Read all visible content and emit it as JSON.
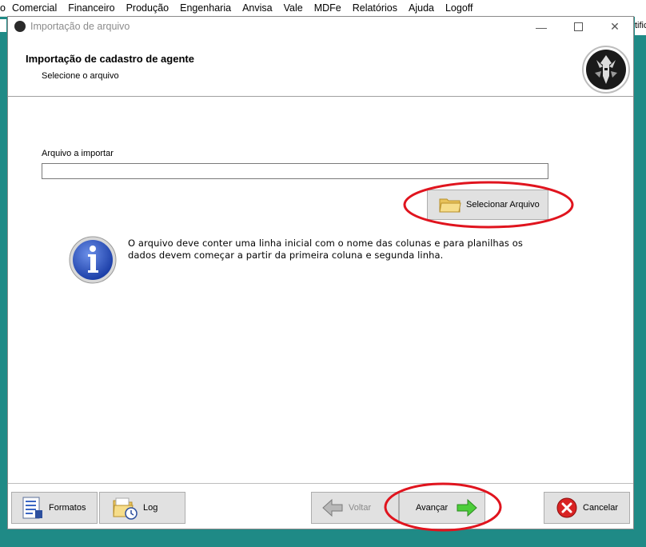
{
  "menubar": {
    "items": [
      "o",
      "Comercial",
      "Financeiro",
      "Produção",
      "Engenharia",
      "Anvisa",
      "Vale",
      "MDFe",
      "Relatórios",
      "Ajuda",
      "Logoff"
    ],
    "right_fragment": "tific"
  },
  "window": {
    "title": "Importação de arquivo",
    "minimize_symbol": "—",
    "close_symbol": "✕"
  },
  "header": {
    "title": "Importação de cadastro de agente",
    "subtitle": "Selecione o arquivo",
    "logo_icon": "warrior-logo-icon"
  },
  "file_field": {
    "label": "Arquivo a importar",
    "value": "",
    "placeholder": ""
  },
  "select_button": {
    "label": "Selecionar Arquivo",
    "icon": "folder-icon"
  },
  "info": {
    "icon": "info-icon",
    "text": "O arquivo deve conter uma linha inicial com o nome das colunas e para planilhas os dados devem começar a partir da primeira coluna e segunda linha."
  },
  "footer": {
    "formatos_label": "Formatos",
    "log_label": "Log",
    "voltar_label": "Voltar",
    "avancar_label": "Avançar",
    "cancelar_label": "Cancelar"
  },
  "colors": {
    "desktop": "#1f8a86",
    "highlight_ellipse": "#e0141e",
    "button_bg": "#e1e1e1"
  }
}
